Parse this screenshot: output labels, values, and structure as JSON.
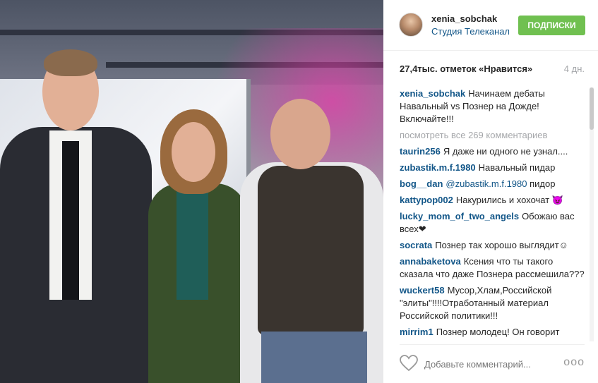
{
  "post": {
    "username": "xenia_sobchak",
    "location": "Студия Телеканала Дождь",
    "follow_label": "ПОДПИСКИ",
    "likes": "27,4тыс. отметок «Нравится»",
    "age": "4 дн.",
    "caption_user": "xenia_sobchak",
    "caption_text": "Начинаем дебаты Навальный vs Познер на Дожде! Включайте!!!",
    "view_all": "посмотреть все 269 комментариев"
  },
  "comments": [
    {
      "user": "taurin256",
      "text": "Я даже ни одного не узнал...."
    },
    {
      "user": "zubastik.m.f.1980",
      "text": "Навальный пидар"
    },
    {
      "user": "bog__dan",
      "mention": "@zubastik.m.f.1980",
      "text": "пидор"
    },
    {
      "user": "kattypop002",
      "text": "Накурились и хохочат 😈"
    },
    {
      "user": "lucky_mom_of_two_angels",
      "text": "Обожаю вас всех❤"
    },
    {
      "user": "socrata",
      "text": "Познер так хорошо выглядит☺"
    },
    {
      "user": "annabaketova",
      "text": "Ксения что ты такого сказала что даже Познера рассмешила???"
    },
    {
      "user": "wuckert58",
      "text": "Мусор,Хлам,Российской \"элиты\"!!!!Отработанный материал Российской политики!!!"
    },
    {
      "user": "mirrim1",
      "text": "Познер молодец! Он говорит очень правильно, на жизнь идет"
    }
  ],
  "footer": {
    "comment_placeholder": "Добавьте комментарий...",
    "more_label": "ooo"
  },
  "icons": {
    "heart": "heart-icon",
    "more": "more-options-icon"
  },
  "colors": {
    "follow": "#70c050",
    "link": "#125688",
    "muted": "#a5a7aa"
  }
}
